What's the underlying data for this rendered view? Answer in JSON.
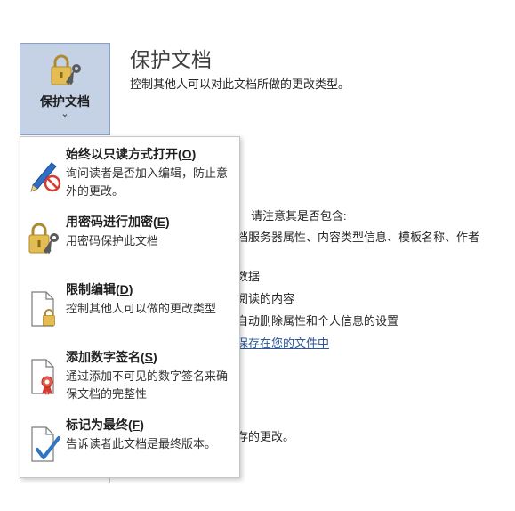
{
  "protect_button": {
    "label": "保护文档",
    "chevron": "⌄",
    "icon": "lock-key-icon"
  },
  "section": {
    "title": "保护文档",
    "description": "控制其他人可以对此文档所做的更改类型。"
  },
  "background": {
    "inspect_intro": "请注意其是否包含:",
    "inspect_item_1": "档服务器属性、内容类型信息、模板名称、作者",
    "inspect_item_2": "数据",
    "inspect_item_3": "阅读的内容",
    "inspect_item_4": "自动删除属性和个人信息的设置",
    "inspect_link": "保存在您的文件中",
    "versions_text": "存的更改。"
  },
  "menu": {
    "items": [
      {
        "title": "始终以只读方式打开(",
        "mnemonic": "O",
        "title_end": ")",
        "desc": "询问读者是否加入编辑，防止意外的更改。",
        "icon": "pencil-no-edit-icon"
      },
      {
        "title": "用密码进行加密(",
        "mnemonic": "E",
        "title_end": ")",
        "desc": "用密码保护此文档",
        "icon": "lock-key-icon"
      },
      {
        "title": "限制编辑(",
        "mnemonic": "D",
        "title_end": ")",
        "desc": "控制其他人可以做的更改类型",
        "icon": "document-lock-icon"
      },
      {
        "title": "添加数字签名(",
        "mnemonic": "S",
        "title_end": ")",
        "desc": "通过添加不可见的数字签名来确保文档的完整性",
        "icon": "document-ribbon-icon"
      },
      {
        "title": "标记为最终(",
        "mnemonic": "F",
        "title_end": ")",
        "desc": "告诉读者此文档是最终版本。",
        "icon": "document-check-icon"
      }
    ]
  },
  "colors": {
    "button_bg": "#c5d2e5",
    "lock_gold": "#e3bd52",
    "accent_blue": "#2b579a",
    "check_blue": "#2e75c3",
    "prohibit_red": "#d63a30"
  }
}
